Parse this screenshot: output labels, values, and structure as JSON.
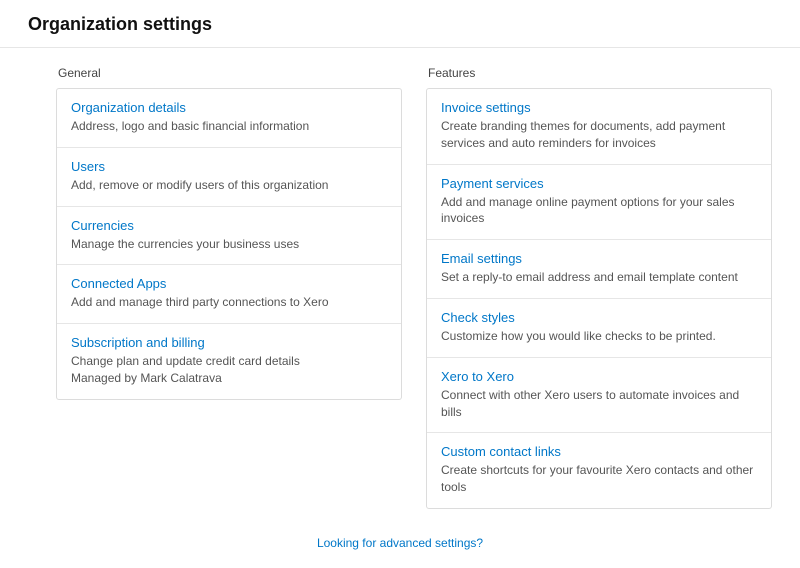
{
  "page_title": "Organization settings",
  "columns": {
    "general": {
      "label": "General",
      "items": [
        {
          "title": "Organization details",
          "desc": "Address, logo and basic financial information",
          "sub": ""
        },
        {
          "title": "Users",
          "desc": "Add, remove or modify users of this organization",
          "sub": ""
        },
        {
          "title": "Currencies",
          "desc": "Manage the currencies your business uses",
          "sub": ""
        },
        {
          "title": "Connected Apps",
          "desc": "Add and manage third party connections to Xero",
          "sub": ""
        },
        {
          "title": "Subscription and billing",
          "desc": "Change plan and update credit card details",
          "sub": "Managed by Mark Calatrava"
        }
      ]
    },
    "features": {
      "label": "Features",
      "items": [
        {
          "title": "Invoice settings",
          "desc": "Create branding themes for documents, add payment services and auto reminders for invoices",
          "sub": ""
        },
        {
          "title": "Payment services",
          "desc": "Add and manage online payment options for your sales invoices",
          "sub": ""
        },
        {
          "title": "Email settings",
          "desc": "Set a reply-to email address and email template content",
          "sub": ""
        },
        {
          "title": "Check styles",
          "desc": "Customize how you would like checks to be printed.",
          "sub": ""
        },
        {
          "title": "Xero to Xero",
          "desc": "Connect with other Xero users to automate invoices and bills",
          "sub": ""
        },
        {
          "title": "Custom contact links",
          "desc": "Create shortcuts for your favourite Xero contacts and other tools",
          "sub": ""
        }
      ]
    }
  },
  "advanced_link": "Looking for advanced settings?"
}
